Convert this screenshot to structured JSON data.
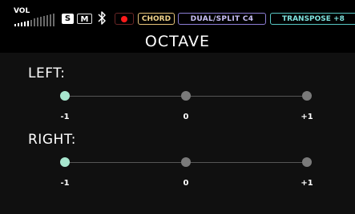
{
  "status_bar": {
    "vol_label": "VOL",
    "volume_level": 0.35,
    "solo_label": "S",
    "mute_label": "M",
    "bluetooth_icon": "bluetooth-icon",
    "record_icon": "record-icon",
    "chord_label": "CHORD",
    "dual_split_label": "DUAL/SPLIT C4",
    "transpose_label": "TRANSPOSE +8",
    "colors": {
      "record": "#ff1a1a",
      "chord": "#f2d48a",
      "dual_split": "#c9c0f5",
      "transpose": "#7fe3df"
    }
  },
  "title": "OCTAVE",
  "left": {
    "label": "LEFT:",
    "options": [
      "-1",
      "0",
      "+1"
    ],
    "selected": "-1"
  },
  "right": {
    "label": "RIGHT:",
    "options": [
      "-1",
      "0",
      "+1"
    ],
    "selected": "-1"
  },
  "colors": {
    "active_dot": "#a8e6cf",
    "inactive_dot": "#7a7a7a"
  }
}
